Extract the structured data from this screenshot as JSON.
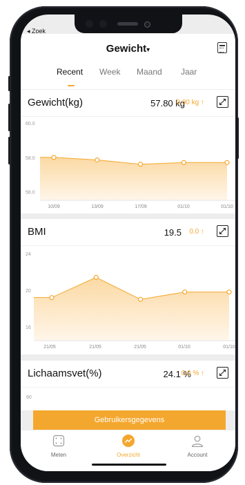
{
  "status": {
    "back_label": "◂ Zoek"
  },
  "header": {
    "title": "Gewicht",
    "caret": "▾"
  },
  "tabs": [
    {
      "label": "Recent",
      "active": true
    },
    {
      "label": "Week",
      "active": false
    },
    {
      "label": "Maand",
      "active": false
    },
    {
      "label": "Jaar",
      "active": false
    }
  ],
  "cards": [
    {
      "title": "Gewicht(kg)",
      "value": "57.80 kg",
      "delta": "0.00 kg ↑",
      "chart_data": {
        "type": "area",
        "categories": [
          "10/09",
          "13/09",
          "17/09",
          "01/10",
          "01/10"
        ],
        "y_ticks": [
          "60.0",
          "58.0",
          "56.0"
        ],
        "values": [
          58.0,
          57.85,
          57.6,
          57.7,
          57.7
        ],
        "ylim": [
          55.5,
          60.0
        ]
      }
    },
    {
      "title": "BMI",
      "value": "19.5",
      "delta": "0.0 ↑",
      "chart_data": {
        "type": "area",
        "categories": [
          "21/05",
          "21/05",
          "21/05",
          "01/10",
          "01/10"
        ],
        "y_ticks": [
          "24",
          "20",
          "16"
        ],
        "values": [
          19.2,
          21.4,
          19.0,
          19.8,
          19.8
        ],
        "ylim": [
          14.5,
          24.0
        ]
      }
    },
    {
      "title": "Lichaamsvet(%)",
      "value": "24.1 %",
      "delta": "0.0 % ↑",
      "chart_data": {
        "type": "area",
        "y_ticks": [
          "60"
        ]
      }
    }
  ],
  "bottom_button": "Gebruikersgegevens",
  "tabbar": [
    {
      "label": "Meten",
      "icon": "scale-icon"
    },
    {
      "label": "Overzicht",
      "icon": "chart-icon",
      "active": true
    },
    {
      "label": "Account",
      "icon": "person-icon"
    }
  ],
  "colors": {
    "accent": "#f4a72e",
    "fill_top": "#fbd9a3",
    "fill_bottom": "#fff6ea"
  }
}
